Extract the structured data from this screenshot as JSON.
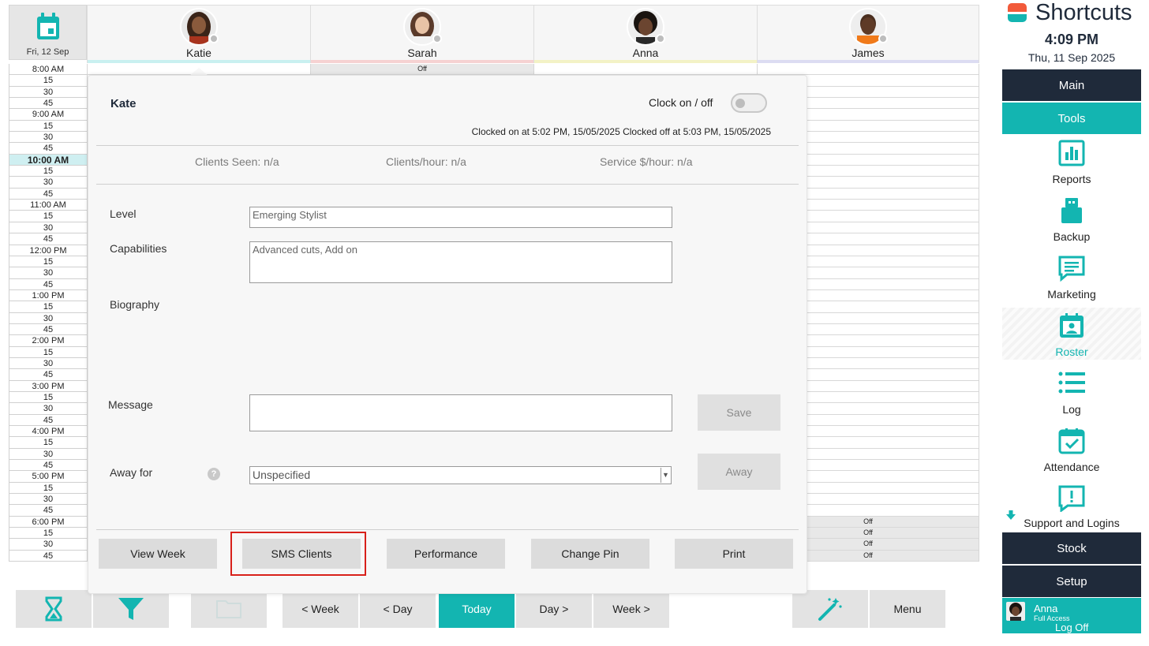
{
  "calendar": {
    "date_label": "Fri, 12 Sep",
    "staff": [
      {
        "name": "Katie",
        "accent": "#c9f0f0"
      },
      {
        "name": "Sarah",
        "accent": "#f6d2d2"
      },
      {
        "name": "Anna",
        "accent": "#f3f2c6"
      },
      {
        "name": "James",
        "accent": "#dcdcf2"
      }
    ],
    "times": [
      "8:00 AM",
      "15",
      "30",
      "45",
      "9:00 AM",
      "15",
      "30",
      "45",
      "10:00 AM",
      "15",
      "30",
      "45",
      "11:00 AM",
      "15",
      "30",
      "45",
      "12:00 PM",
      "15",
      "30",
      "45",
      "1:00 PM",
      "15",
      "30",
      "45",
      "2:00 PM",
      "15",
      "30",
      "45",
      "3:00 PM",
      "15",
      "30",
      "45",
      "4:00 PM",
      "15",
      "30",
      "45",
      "5:00 PM",
      "15",
      "30",
      "45",
      "6:00 PM",
      "15",
      "30",
      "45"
    ],
    "current_time_index": 8,
    "off_label": "Off"
  },
  "toolbar": {
    "prev_week": "< Week",
    "prev_day": "< Day",
    "today": "Today",
    "next_day": "Day >",
    "next_week": "Week >",
    "menu": "Menu"
  },
  "staff_panel": {
    "name": "Kate",
    "clock_label": "Clock on / off",
    "clock_on": false,
    "clocked_text": "Clocked on at 5:02 PM, 15/05/2025  Clocked off at 5:03 PM, 15/05/2025",
    "stats": {
      "clients_seen": "Clients Seen: n/a",
      "clients_per_hour": "Clients/hour: n/a",
      "service_per_hour": "Service $/hour: n/a"
    },
    "level_label": "Level",
    "level_value": "Emerging Stylist",
    "capabilities_label": "Capabilities",
    "capabilities_value": "Advanced cuts, Add on",
    "biography_label": "Biography",
    "message_label": "Message",
    "message_value": "",
    "save_label": "Save",
    "away_label": "Away for",
    "help_label": "?",
    "away_value": "Unspecified",
    "away_button": "Away",
    "actions": {
      "view_week": "View Week",
      "sms_clients": "SMS Clients",
      "performance": "Performance",
      "change_pin": "Change Pin",
      "print": "Print"
    }
  },
  "sidebar": {
    "brand": "Shortcuts",
    "time": "4:09 PM",
    "date": "Thu, 11 Sep 2025",
    "main": "Main",
    "tools": "Tools",
    "items": [
      {
        "label": "Reports",
        "icon": "reports-icon"
      },
      {
        "label": "Backup",
        "icon": "backup-icon"
      },
      {
        "label": "Marketing",
        "icon": "marketing-icon"
      },
      {
        "label": "Roster",
        "icon": "roster-icon"
      },
      {
        "label": "Log",
        "icon": "log-icon"
      },
      {
        "label": "Attendance",
        "icon": "attendance-icon"
      },
      {
        "label": "Support and Logins",
        "icon": "support-icon"
      }
    ],
    "stock": "Stock",
    "setup": "Setup",
    "user": {
      "name": "Anna",
      "role": "Full Access",
      "logoff": "Log Off"
    }
  },
  "colors": {
    "teal": "#13b5b1",
    "navy": "#1f2a3a",
    "highlight": "#d8201a"
  }
}
